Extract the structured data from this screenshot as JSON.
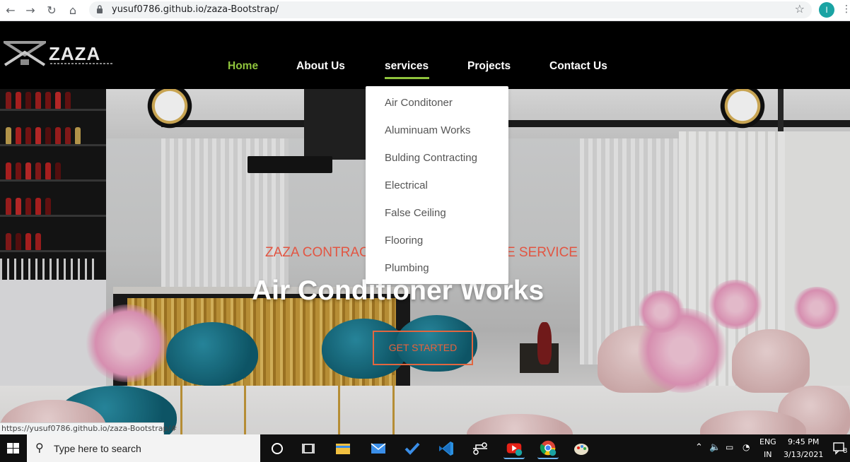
{
  "browser": {
    "url": "yusuf0786.github.io/zaza-Bootstrap/",
    "profile_initial": "I",
    "back_glyph": "←",
    "forward_glyph": "→",
    "reload_glyph": "↻",
    "home_glyph": "⌂",
    "star_glyph": "☆",
    "menu_glyph": "⋮"
  },
  "site": {
    "logo_text": "ZAZA",
    "nav": [
      {
        "label": "Home",
        "active": true
      },
      {
        "label": "About Us"
      },
      {
        "label": "services",
        "open": true
      },
      {
        "label": "Projects"
      },
      {
        "label": "Contact Us"
      }
    ],
    "dropdown": [
      "Air Conditoner",
      "Aluminuam Works",
      "Bulding Contracting",
      "Electrical",
      "False Ceiling",
      "Flooring",
      "Plumbing"
    ],
    "hero": {
      "subtitle": "ZAZA CONTRACTING & MAINTENANCE SERVICE",
      "title": "Air Conditioner Works",
      "button": "GET STARTED"
    }
  },
  "status_bar": "https://yusuf0786.github.io/zaza-Bootstrap/#",
  "taskbar": {
    "search_placeholder": "Type here to search",
    "search_glyph": "⚲",
    "apps": [
      "task-view",
      "file-explorer",
      "mail",
      "todo",
      "vscode",
      "git",
      "youtube",
      "chrome",
      "paint"
    ],
    "tray": {
      "lang_top": "ENG",
      "lang_bottom": "IN",
      "time": "9:45 PM",
      "date": "3/13/2021",
      "notification_count": "8"
    }
  },
  "colors": {
    "nav_active": "#8fc43c",
    "hero_subtitle": "#e25542",
    "button_border": "#e2663f"
  }
}
